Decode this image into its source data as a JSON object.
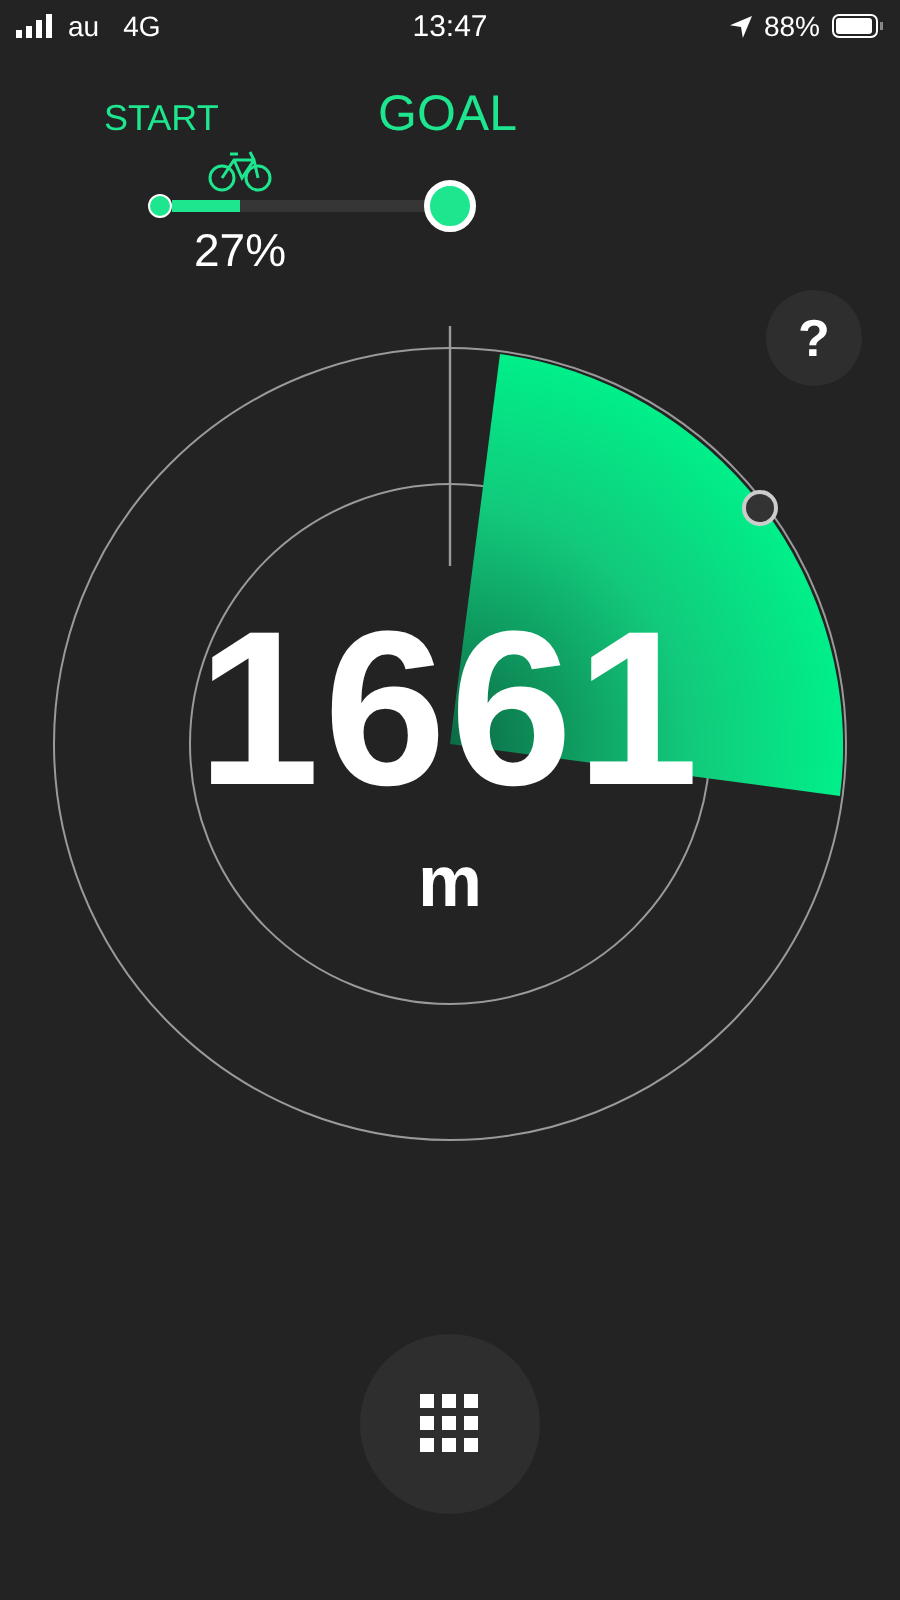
{
  "status_bar": {
    "carrier": "au",
    "network": "4G",
    "time": "13:47",
    "battery": "88%"
  },
  "progress": {
    "start_label": "START",
    "goal_label": "GOAL",
    "level": 0.27,
    "percent": "27%"
  },
  "help_button": {
    "label": "?"
  },
  "distance": {
    "value": "1661",
    "unit": "m"
  }
}
